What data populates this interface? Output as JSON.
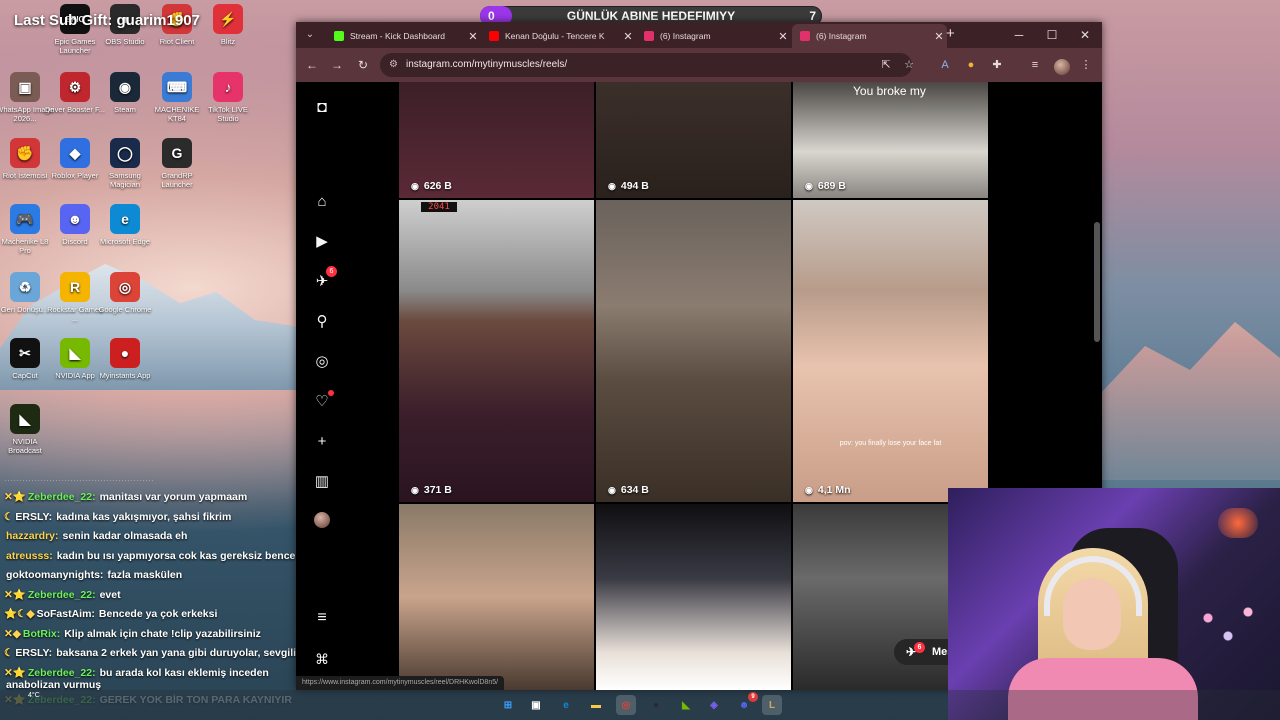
{
  "overlay": {
    "stream_title": "Last Sub Gift: guarim1907",
    "goal": {
      "start": "0",
      "label": "GÜNLÜK ABINE HEDEFIMIYY",
      "target": "7",
      "progress": 0.0,
      "fill_color": "#9b36ea"
    }
  },
  "desktop_icons": [
    {
      "label": "Epic Games Launcher",
      "icon": "epic-games-icon",
      "color": "#111111",
      "glyph": "EPIC"
    },
    {
      "label": "OBS Studio",
      "icon": "obs-icon",
      "color": "#2a2a2a",
      "glyph": "●"
    },
    {
      "label": "Riot Client",
      "icon": "riot-icon",
      "color": "#d13639",
      "glyph": "✊"
    },
    {
      "label": "Blitz",
      "icon": "blitz-icon",
      "color": "#e0303a",
      "glyph": "⚡"
    },
    {
      "label": "WhatsApp Image 2026...",
      "icon": "image-file-icon",
      "color": "#7a5c54",
      "glyph": "▣"
    },
    {
      "label": "Driver Booster F...",
      "icon": "driver-booster-icon",
      "color": "#c0262d",
      "glyph": "⚙"
    },
    {
      "label": "Steam",
      "icon": "steam-icon",
      "color": "#1b2838",
      "glyph": "◉"
    },
    {
      "label": "MACHENIKE KT84",
      "icon": "machenike-kt84-icon",
      "color": "#3a7bd5",
      "glyph": "⌨"
    },
    {
      "label": "TikTok LIVE Studio",
      "icon": "tiktok-live-icon",
      "color": "#e6336a",
      "glyph": "♪"
    },
    {
      "label": "Riot İstemcisi",
      "icon": "riot-client-icon",
      "color": "#d13639",
      "glyph": "✊"
    },
    {
      "label": "Roblox Player",
      "icon": "roblox-icon",
      "color": "#2f6fe0",
      "glyph": "◆"
    },
    {
      "label": "Samsung Magician",
      "icon": "samsung-magician-icon",
      "color": "#1a2a4a",
      "glyph": "◯"
    },
    {
      "label": "GrandRP Launcher",
      "icon": "grandrp-icon",
      "color": "#2b2b2b",
      "glyph": "G"
    },
    {
      "label": "Machenike L8 Pro",
      "icon": "machenike-l8-icon",
      "color": "#2c7be5",
      "glyph": "🎮"
    },
    {
      "label": "Discord",
      "icon": "discord-icon",
      "color": "#5865f2",
      "glyph": "☻"
    },
    {
      "label": "Microsoft Edge",
      "icon": "edge-icon",
      "color": "#0c8bd4",
      "glyph": "e"
    },
    {
      "label": "Geri Dönüşü...",
      "icon": "recycle-bin-icon",
      "color": "#6aa6d8",
      "glyph": "♻"
    },
    {
      "label": "Rockstar Games ...",
      "icon": "rockstar-icon",
      "color": "#f4b400",
      "glyph": "R"
    },
    {
      "label": "Google Chrome",
      "icon": "chrome-icon",
      "color": "#db4437",
      "glyph": "◎"
    },
    {
      "label": "CapCut",
      "icon": "capcut-icon",
      "color": "#111111",
      "glyph": "✂"
    },
    {
      "label": "NVIDIA App",
      "icon": "nvidia-icon",
      "color": "#76b900",
      "glyph": "◣"
    },
    {
      "label": "Myinstants App",
      "icon": "myinstants-icon",
      "color": "#cc1f1f",
      "glyph": "●"
    },
    {
      "label": "NVIDIA Broadcast",
      "icon": "nvidia-broadcast-icon",
      "color": "#1e2b12",
      "glyph": "◣"
    }
  ],
  "chat": {
    "messages": [
      {
        "badges": "✕⭐",
        "user": "Zeberdee_22:",
        "user_color": "#6cf05a",
        "text": "manitası var yorum yapmaam"
      },
      {
        "badges": "☾",
        "user": "ERSLY:",
        "user_color": "#ffffff",
        "text": "kadına kas yakışmıyor, şahsi fikrim"
      },
      {
        "badges": "",
        "user": "hazzardry:",
        "user_color": "#ffd34d",
        "text": "senin kadar olmasada eh"
      },
      {
        "badges": "",
        "user": "atreusss:",
        "user_color": "#ffd34d",
        "text": "kadın bu ısı yapmıyorsa cok kas gereksiz bence"
      },
      {
        "badges": "",
        "user": "goktoomanynights:",
        "user_color": "#ffffff",
        "text": "fazla maskülen"
      },
      {
        "badges": "✕⭐",
        "user": "Zeberdee_22:",
        "user_color": "#6cf05a",
        "text": "evet"
      },
      {
        "badges": "⭐☾◆",
        "user": "SoFastAim:",
        "user_color": "#ffffff",
        "text": "Bencede ya çok erkeksi"
      },
      {
        "badges": "✕◆",
        "user": "BotRix:",
        "user_color": "#6cf05a",
        "text": "Klip almak için chate !clip yazabilirsiniz"
      },
      {
        "badges": "☾",
        "user": "ERSLY:",
        "user_color": "#ffffff",
        "text": "baksana 2 erkek yan yana gibi duruyolar, sevgilisiyle"
      },
      {
        "badges": "✕⭐",
        "user": "Zeberdee_22:",
        "user_color": "#6cf05a",
        "text": "bu arada kol kası eklemiş inceden"
      },
      {
        "badges": "",
        "user": "anabolizan vurmuş",
        "user_color": "#ffffff",
        "text": ""
      },
      {
        "badges": "✕⭐",
        "user": "Zeberdee_22:",
        "user_color": "#6cf05a",
        "text": "GEREK YOK BİR TON PARA KAYNIYIR"
      }
    ]
  },
  "browser": {
    "tabs": [
      {
        "title": "Stream - Kick Dashboard",
        "favicon_color": "#53fc18",
        "active": false
      },
      {
        "title": "Kenan Doğulu - Tencere K",
        "favicon_color": "#ff0000",
        "active": false
      },
      {
        "title": "(6) Instagram",
        "favicon_color": "#e1306c",
        "active": false
      },
      {
        "title": "(6) Instagram",
        "favicon_color": "#e1306c",
        "active": true
      }
    ],
    "url": "instagram.com/mytinymuscles/reels/",
    "status_url": "https://www.instagram.com/mytinymuscles/reel/DRHKwolD8n5/"
  },
  "instagram": {
    "sidebar": [
      {
        "name": "home-icon",
        "glyph": "⌂"
      },
      {
        "name": "reels-icon",
        "glyph": "▶"
      },
      {
        "name": "messages-icon",
        "glyph": "✈",
        "badge": "6"
      },
      {
        "name": "search-icon",
        "glyph": "⚲"
      },
      {
        "name": "explore-icon",
        "glyph": "◎"
      },
      {
        "name": "notifications-icon",
        "glyph": "♡",
        "dot": true
      },
      {
        "name": "create-icon",
        "glyph": "+"
      },
      {
        "name": "dashboard-icon",
        "glyph": "▥"
      }
    ],
    "reels": [
      {
        "views": "626 B",
        "caption": ""
      },
      {
        "views": "494 B",
        "caption": ""
      },
      {
        "views": "689 B",
        "caption": "You broke my"
      },
      {
        "views": "371 B",
        "caption": "2041"
      },
      {
        "views": "634 B",
        "caption": ""
      },
      {
        "views": "4,1 Mn",
        "caption": "pov: you finally lose your face fat"
      },
      {
        "views": "",
        "caption": ""
      },
      {
        "views": "",
        "caption": ""
      },
      {
        "views": "",
        "caption": ""
      }
    ],
    "messages_pill": {
      "label": "Mes",
      "badge": "6"
    }
  },
  "taskbar": {
    "weather": "4°C",
    "apps": [
      {
        "name": "start-icon",
        "glyph": "⊞",
        "color": "#3aa0ff"
      },
      {
        "name": "task-view-icon",
        "glyph": "▣",
        "color": "#ffffff"
      },
      {
        "name": "edge-taskbar-icon",
        "glyph": "e",
        "color": "#0c8bd4"
      },
      {
        "name": "file-explorer-icon",
        "glyph": "▬",
        "color": "#f7c948"
      },
      {
        "name": "chrome-taskbar-icon",
        "glyph": "◎",
        "color": "#db4437"
      },
      {
        "name": "obs-taskbar-icon",
        "glyph": "●",
        "color": "#2a2a2a"
      },
      {
        "name": "nvidia-taskbar-icon",
        "glyph": "◣",
        "color": "#76b900"
      },
      {
        "name": "app-taskbar-icon",
        "glyph": "◈",
        "color": "#7b5cf0"
      },
      {
        "name": "discord-taskbar-icon",
        "glyph": "☻",
        "color": "#5865f2",
        "badge": "9"
      },
      {
        "name": "lol-taskbar-icon",
        "glyph": "L",
        "color": "#c8aa6e"
      }
    ]
  }
}
